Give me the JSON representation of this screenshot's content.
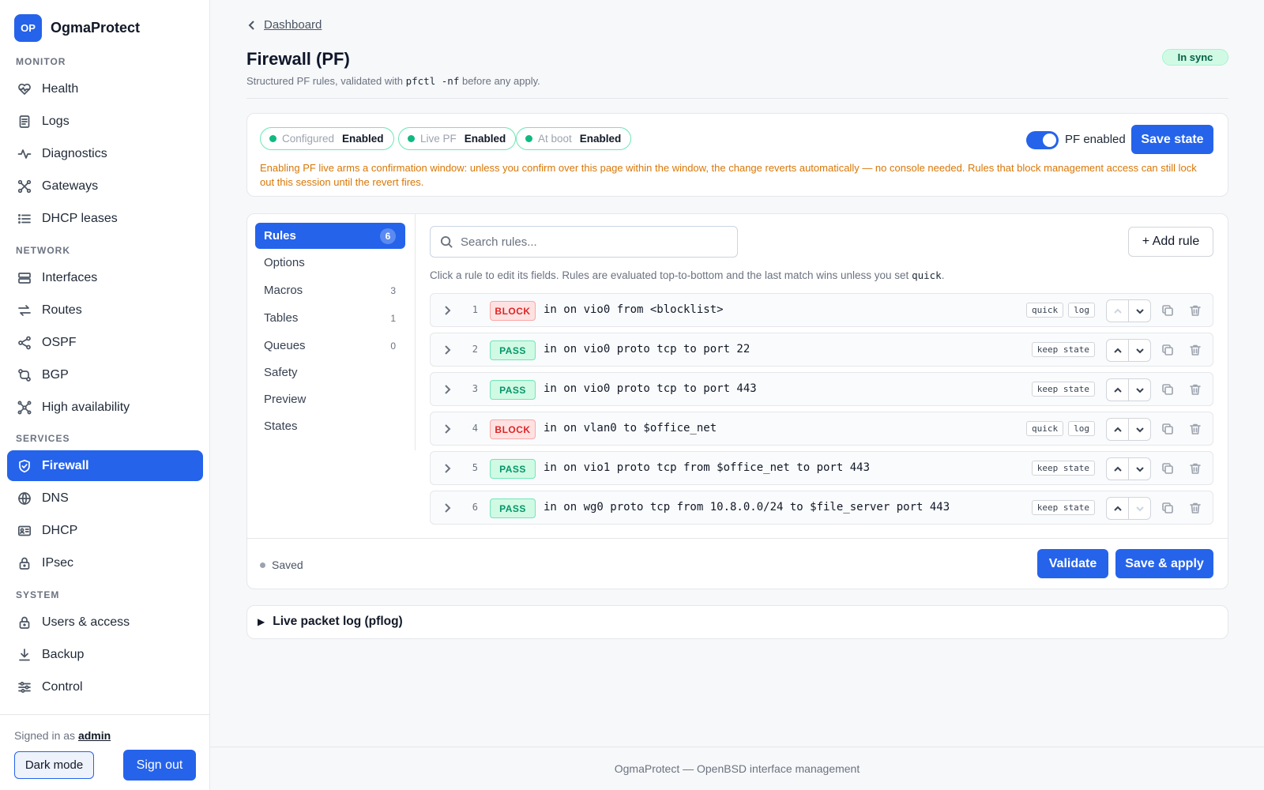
{
  "brand": {
    "logo": "OP",
    "name": "OgmaProtect"
  },
  "sidebar": {
    "sections": [
      {
        "label": "MONITOR",
        "items": [
          {
            "label": "Health",
            "icon": "heart-pulse-icon"
          },
          {
            "label": "Logs",
            "icon": "document-icon"
          },
          {
            "label": "Diagnostics",
            "icon": "activity-icon"
          },
          {
            "label": "Gateways",
            "icon": "route-x-icon"
          },
          {
            "label": "DHCP leases",
            "icon": "list-icon"
          }
        ]
      },
      {
        "label": "NETWORK",
        "items": [
          {
            "label": "Interfaces",
            "icon": "server-icon"
          },
          {
            "label": "Routes",
            "icon": "arrows-icon"
          },
          {
            "label": "OSPF",
            "icon": "share-icon"
          },
          {
            "label": "BGP",
            "icon": "route-icon"
          },
          {
            "label": "High availability",
            "icon": "cluster-icon"
          }
        ]
      },
      {
        "label": "SERVICES",
        "items": [
          {
            "label": "Firewall",
            "icon": "shield-icon",
            "active": true
          },
          {
            "label": "DNS",
            "icon": "globe-icon"
          },
          {
            "label": "DHCP",
            "icon": "id-card-icon"
          },
          {
            "label": "IPsec",
            "icon": "lock-icon"
          }
        ]
      },
      {
        "label": "SYSTEM",
        "items": [
          {
            "label": "Users & access",
            "icon": "lock-icon"
          },
          {
            "label": "Backup",
            "icon": "download-icon"
          },
          {
            "label": "Control",
            "icon": "sliders-icon"
          }
        ]
      }
    ],
    "signed_in_prefix": "Signed in as",
    "user": "admin",
    "dark_mode_label": "Dark mode",
    "sign_out_label": "Sign out"
  },
  "header": {
    "breadcrumb": "Dashboard",
    "title": "Firewall (PF)",
    "subtitle_pre": "Structured PF rules, validated with",
    "subtitle_code": "pfctl -nf",
    "subtitle_post": "before any apply.",
    "sync_badge": "In sync"
  },
  "status": {
    "pills": [
      {
        "label": "Configured",
        "value": "Enabled"
      },
      {
        "label": "Live PF",
        "value": "Enabled"
      },
      {
        "label": "At boot",
        "value": "Enabled"
      }
    ],
    "toggle_label": "PF enabled",
    "toggle_on": true,
    "save_state_label": "Save state",
    "warning": "Enabling PF live arms a confirmation window: unless you confirm over this page within the window, the change reverts automatically — no console needed. Rules that block management access can still lock out this session until the revert fires."
  },
  "tabs": [
    {
      "label": "Rules",
      "count": "6",
      "active": true
    },
    {
      "label": "Options",
      "count": ""
    },
    {
      "label": "Macros",
      "count": "3"
    },
    {
      "label": "Tables",
      "count": "1"
    },
    {
      "label": "Queues",
      "count": "0"
    },
    {
      "label": "Safety",
      "count": ""
    },
    {
      "label": "Preview",
      "count": ""
    },
    {
      "label": "States",
      "count": ""
    }
  ],
  "rules_panel": {
    "search_placeholder": "Search rules...",
    "add_rule_label": "+ Add rule",
    "hint_pre": "Click a rule to edit its fields. Rules are evaluated top-to-bottom and the last match wins unless you set",
    "hint_code": "quick",
    "hint_post": ".",
    "rules": [
      {
        "num": "1",
        "action": "BLOCK",
        "expr": "in on vio0 from <blocklist>",
        "tags": [
          "quick",
          "log"
        ]
      },
      {
        "num": "2",
        "action": "PASS",
        "expr": "in on vio0 proto tcp to port 22",
        "tags": [
          "keep state"
        ]
      },
      {
        "num": "3",
        "action": "PASS",
        "expr": "in on vio0 proto tcp to port 443",
        "tags": [
          "keep state"
        ]
      },
      {
        "num": "4",
        "action": "BLOCK",
        "expr": "in on vlan0 to $office_net",
        "tags": [
          "quick",
          "log"
        ]
      },
      {
        "num": "5",
        "action": "PASS",
        "expr": "in on vio1 proto tcp from $office_net to port 443",
        "tags": [
          "keep state"
        ]
      },
      {
        "num": "6",
        "action": "PASS",
        "expr": "in on wg0 proto tcp from 10.8.0.0/24 to $file_server port 443",
        "tags": [
          "keep state"
        ]
      }
    ],
    "saved_label": "Saved",
    "validate_label": "Validate",
    "save_apply_label": "Save & apply"
  },
  "pflog": {
    "title": "Live packet log (pflog)"
  },
  "footer": {
    "text": "OgmaProtect — OpenBSD interface management"
  }
}
